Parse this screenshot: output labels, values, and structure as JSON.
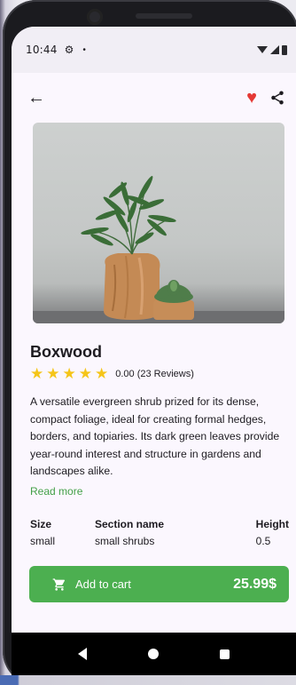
{
  "status_bar": {
    "time": "10:44",
    "icons": [
      "gear-icon",
      "dot-icon",
      "wifi-icon",
      "signal-icon",
      "battery-icon"
    ]
  },
  "toolbar": {
    "back_icon": "arrow-left-icon",
    "favorite_icon": "heart-icon",
    "favorite_color": "#e53935",
    "share_icon": "share-icon"
  },
  "product": {
    "image_icon": "plant-photo",
    "name": "Boxwood",
    "rating_stars": 5,
    "rating_text": "0.00 (23 Reviews)",
    "star_color": "#f5c518",
    "description": "A versatile evergreen shrub prized for its dense, compact foliage, ideal for creating formal hedges, borders, and topiaries. Its dark green leaves provide year-round interest and structure in gardens and landscapes alike.",
    "read_more": "Read more",
    "read_more_color": "#43a047",
    "specs": [
      {
        "label": "Size",
        "value": "small"
      },
      {
        "label": "Section name",
        "value": "small shrubs"
      },
      {
        "label": "Height",
        "value": "0.5"
      }
    ]
  },
  "cart_button": {
    "icon": "cart-icon",
    "label": "Add to cart",
    "price": "25.99$",
    "color": "#4caf50"
  },
  "nav_bar": {
    "icons": [
      "back-triangle-icon",
      "home-circle-icon",
      "recents-square-icon"
    ]
  }
}
